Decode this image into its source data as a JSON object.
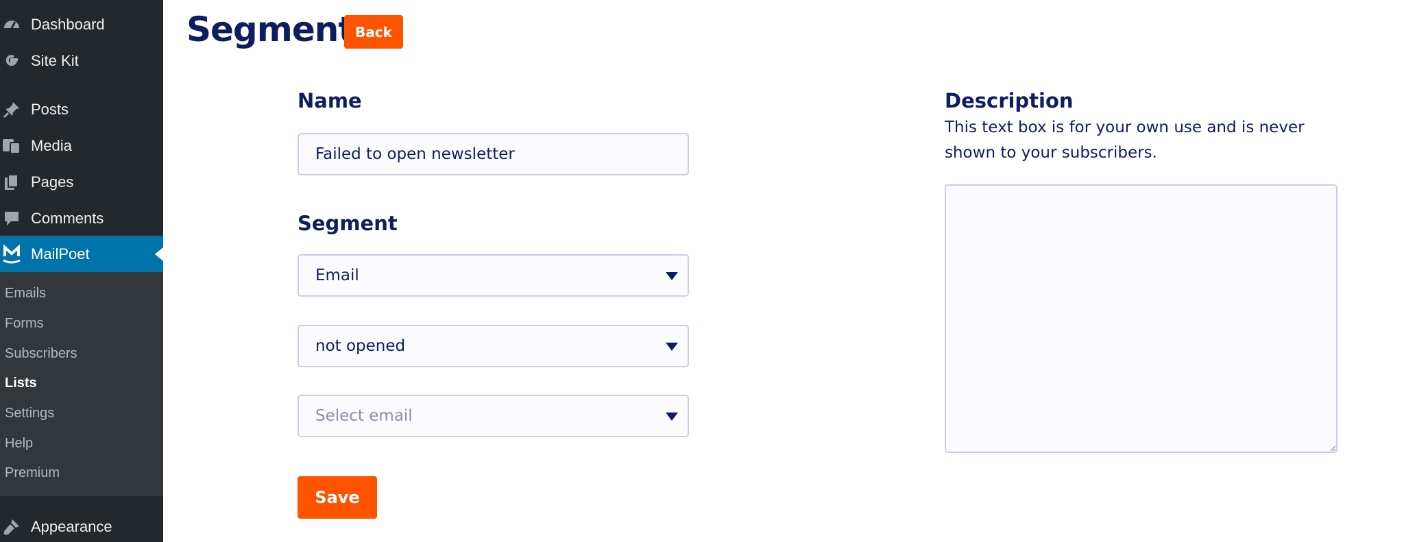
{
  "sidebar": {
    "items": [
      {
        "label": "Dashboard",
        "icon": "dashboard-icon"
      },
      {
        "label": "Site Kit",
        "icon": "google-g-icon"
      },
      {
        "label": "Posts",
        "icon": "pushpin-icon"
      },
      {
        "label": "Media",
        "icon": "media-icon"
      },
      {
        "label": "Pages",
        "icon": "pages-icon"
      },
      {
        "label": "Comments",
        "icon": "comment-bubble-icon"
      },
      {
        "label": "MailPoet",
        "icon": "mailpoet-logo-icon"
      },
      {
        "label": "Appearance",
        "icon": "paintbrush-icon"
      }
    ],
    "submenu": [
      "Emails",
      "Forms",
      "Subscribers",
      "Lists",
      "Settings",
      "Help",
      "Premium"
    ],
    "current_submenu": "Lists"
  },
  "header": {
    "title": "Segment",
    "back_label": "Back"
  },
  "form": {
    "name_label": "Name",
    "name_value": "Failed to open newsletter",
    "segment_label": "Segment",
    "segment_type": "Email",
    "segment_action": "not opened",
    "select_email_placeholder": "Select email",
    "save_label": "Save"
  },
  "description": {
    "label": "Description",
    "help_text": "This text box is for your own use and is never shown to your subscribers.",
    "value": ""
  },
  "colors": {
    "brand_navy": "#0e1d5e",
    "accent_orange": "#fe5301",
    "sidebar_bg": "#23282d",
    "sidebar_active": "#0073aa"
  }
}
